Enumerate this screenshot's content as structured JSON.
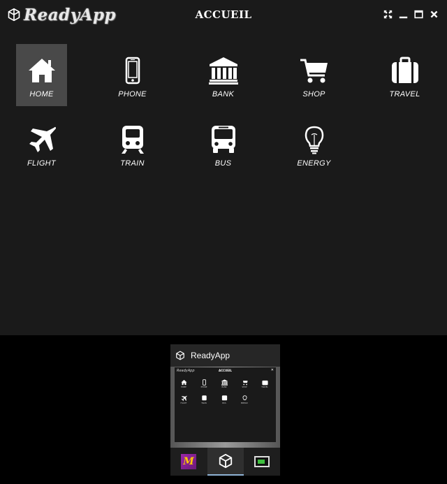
{
  "app": {
    "name": "ReadyApp",
    "title": "ACCUEIL"
  },
  "window_controls": [
    {
      "name": "fullscreen-icon"
    },
    {
      "name": "minimize-icon"
    },
    {
      "name": "maximize-icon"
    },
    {
      "name": "close-icon"
    }
  ],
  "tiles": [
    {
      "label": "HOME",
      "icon": "home-icon",
      "active": true
    },
    {
      "label": "PHONE",
      "icon": "phone-icon",
      "active": false
    },
    {
      "label": "BANK",
      "icon": "bank-icon",
      "active": false
    },
    {
      "label": "SHOP",
      "icon": "cart-icon",
      "active": false
    },
    {
      "label": "TRAVEL",
      "icon": "suitcase-icon",
      "active": false
    },
    {
      "label": "FLIGHT",
      "icon": "plane-icon",
      "active": false
    },
    {
      "label": "TRAIN",
      "icon": "train-icon",
      "active": false
    },
    {
      "label": "BUS",
      "icon": "bus-icon",
      "active": false
    },
    {
      "label": "ENERGY",
      "icon": "bulb-icon",
      "active": false
    }
  ],
  "switcher": {
    "title": "ReadyApp",
    "tasks": [
      {
        "name": "m-app-icon",
        "badge": "M"
      },
      {
        "name": "readyapp-task-icon"
      },
      {
        "name": "terminal-icon"
      }
    ]
  },
  "colors": {
    "window_bg": "#1a1a1a",
    "active_tile": "#494949",
    "accent_underline": "#8fb3d6"
  }
}
